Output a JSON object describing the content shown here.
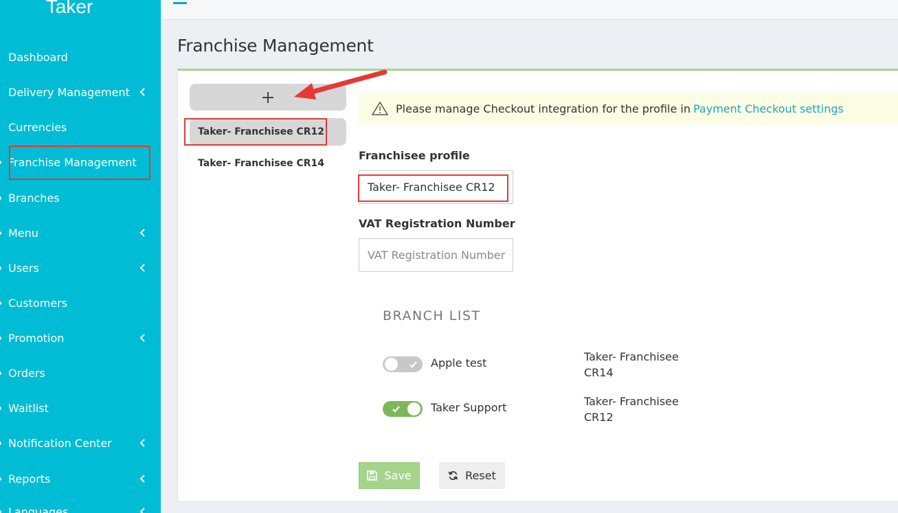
{
  "app": {
    "brand": "Taker"
  },
  "sidebar": {
    "items": [
      {
        "label": "Dashboard",
        "has_chevron": false
      },
      {
        "label": "Delivery Management",
        "has_chevron": true
      },
      {
        "label": "Currencies",
        "has_chevron": false
      },
      {
        "label": "Franchise Management",
        "has_chevron": false,
        "active": true
      },
      {
        "label": "Branches",
        "has_chevron": false
      },
      {
        "label": "Menu",
        "has_chevron": true
      },
      {
        "label": "Users",
        "has_chevron": true
      },
      {
        "label": "Customers",
        "has_chevron": false
      },
      {
        "label": "Promotion",
        "has_chevron": true
      },
      {
        "label": "Orders",
        "has_chevron": false
      },
      {
        "label": "Waitlist",
        "has_chevron": false
      },
      {
        "label": "Notification Center",
        "has_chevron": true
      },
      {
        "label": "Reports",
        "has_chevron": true
      },
      {
        "label": "Languages",
        "has_chevron": true
      }
    ]
  },
  "page": {
    "title": "Franchise Management"
  },
  "profiles": {
    "add_icon": "plus-icon",
    "items": [
      {
        "label": "Taker- Franchisee CR12",
        "selected": true
      },
      {
        "label": "Taker- Franchisee CR14",
        "selected": false
      }
    ]
  },
  "alert": {
    "icon": "warning-icon",
    "text": "Please manage Checkout integration for the profile in",
    "link": "Payment Checkout settings"
  },
  "form": {
    "profile_label": "Franchisee profile",
    "profile_value": "Taker- Franchisee CR12",
    "vat_label": "VAT Registration Number",
    "vat_placeholder": "VAT Registration Number"
  },
  "branch_list": {
    "title": "BRANCH LIST",
    "rows": [
      {
        "name": "Apple test",
        "enabled": false,
        "owner_line1": "Taker- Franchisee",
        "owner_line2": "CR14"
      },
      {
        "name": "Taker Support",
        "enabled": true,
        "owner_line1": "Taker- Franchisee",
        "owner_line2": "CR12"
      }
    ]
  },
  "actions": {
    "save": "Save",
    "reset": "Reset"
  },
  "colors": {
    "sidebar": "#00bcd4",
    "accent": "#a5d58a",
    "link": "#1aa5c7",
    "highlight": "#e53935"
  }
}
